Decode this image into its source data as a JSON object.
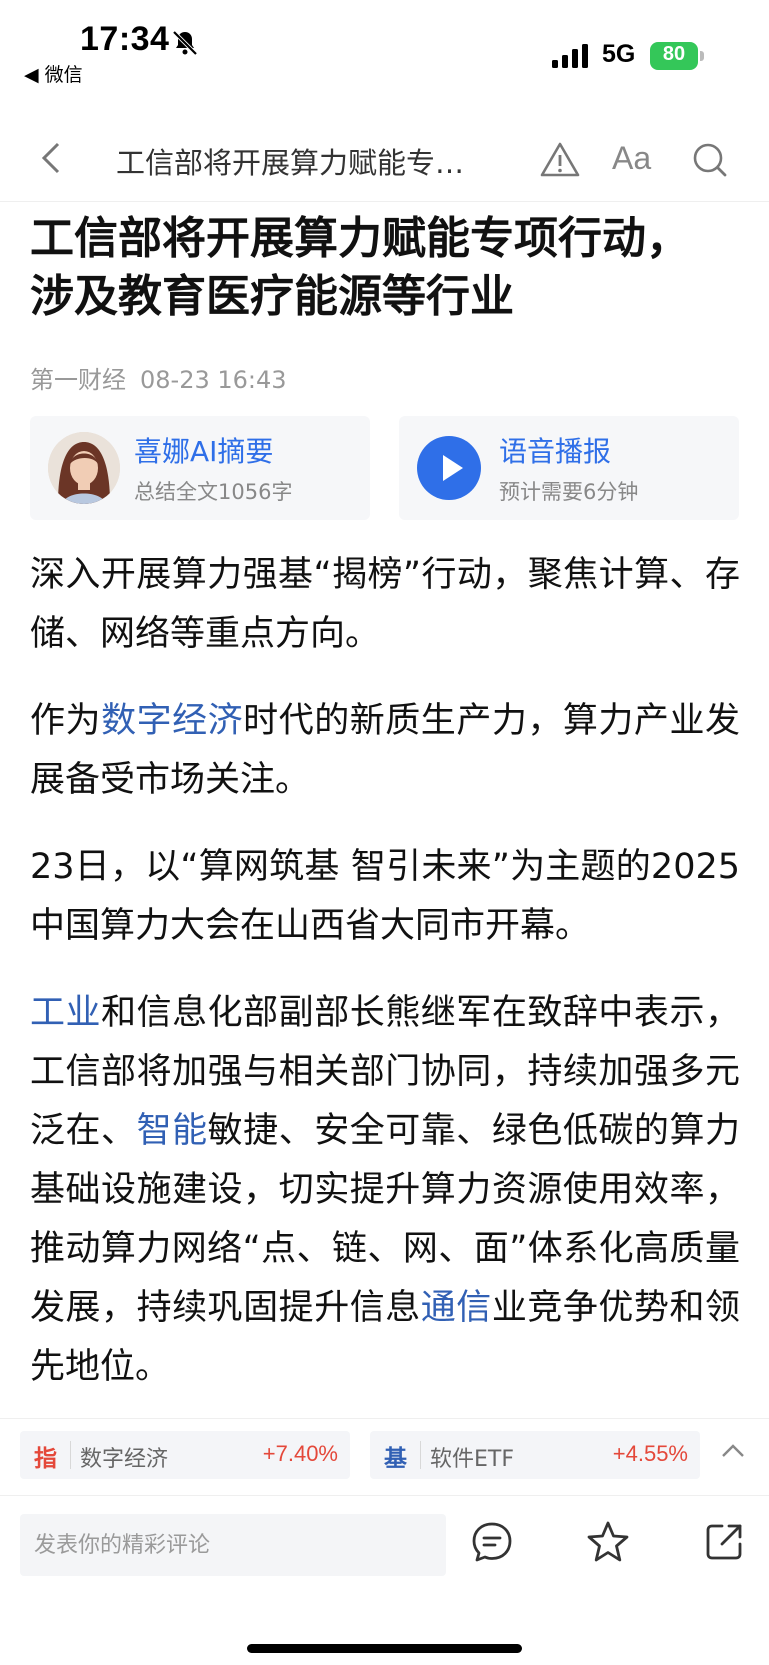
{
  "status_bar": {
    "time": "17:34",
    "back_app": "◀ 微信",
    "network": "5G",
    "battery": "80"
  },
  "nav": {
    "title": "工信部将开展算力赋能专…",
    "font_label": "Aa"
  },
  "article": {
    "headline": "工信部将开展算力赋能专项行动，涉及教育医疗能源等行业",
    "source": "第一财经",
    "datetime": "08-23 16:43",
    "paragraphs": {
      "p1": "深入开展算力强基“揭榜”行动，聚焦计算、存储、网络等重点方向。",
      "p2": {
        "a": "作为",
        "link": "数字经济",
        "b": "时代的新质生产力，算力产业发展备受市场关注。"
      },
      "p3": "23日，以“算网筑基 智引未来”为主题的2025中国算力大会在山西省大同市开幕。",
      "p4": {
        "link1": "工业",
        "a": "和信息化部副部长熊继军在致辞中表示，工信部将加强与相关部门协同，持续加强多元泛在、",
        "link2": "智能",
        "b": "敏捷、安全可靠、绿色低碳的算力基础设施建设，切实提升算力资源使用效率，推动算力网络“点、链、网、面”体系化高质量发展，持续巩固提升信息",
        "link3": "通信",
        "c": "业竞争优势和领先地位。"
      }
    }
  },
  "cards": {
    "ai": {
      "title": "喜娜AI摘要",
      "sub": "总结全文1056字"
    },
    "audio": {
      "title": "语音播报",
      "sub": "预计需要6分钟"
    }
  },
  "ticker": {
    "items": [
      {
        "tag": "指",
        "name": "数字经济",
        "value": "+7.40%"
      },
      {
        "tag": "基",
        "name": "软件ETF",
        "value": "+4.55%"
      }
    ]
  },
  "bottom": {
    "comment_placeholder": "发表你的精彩评论"
  },
  "colors": {
    "link": "#3160b4",
    "accent_blue": "#2f6fe8",
    "up_red": "#e4483a",
    "battery_green": "#34c759"
  },
  "icons": [
    "bell-muted-icon",
    "signal-icon",
    "back-chevron-icon",
    "warning-icon",
    "search-icon",
    "play-icon",
    "chevron-up-icon",
    "comment-icon",
    "star-icon",
    "share-icon"
  ]
}
